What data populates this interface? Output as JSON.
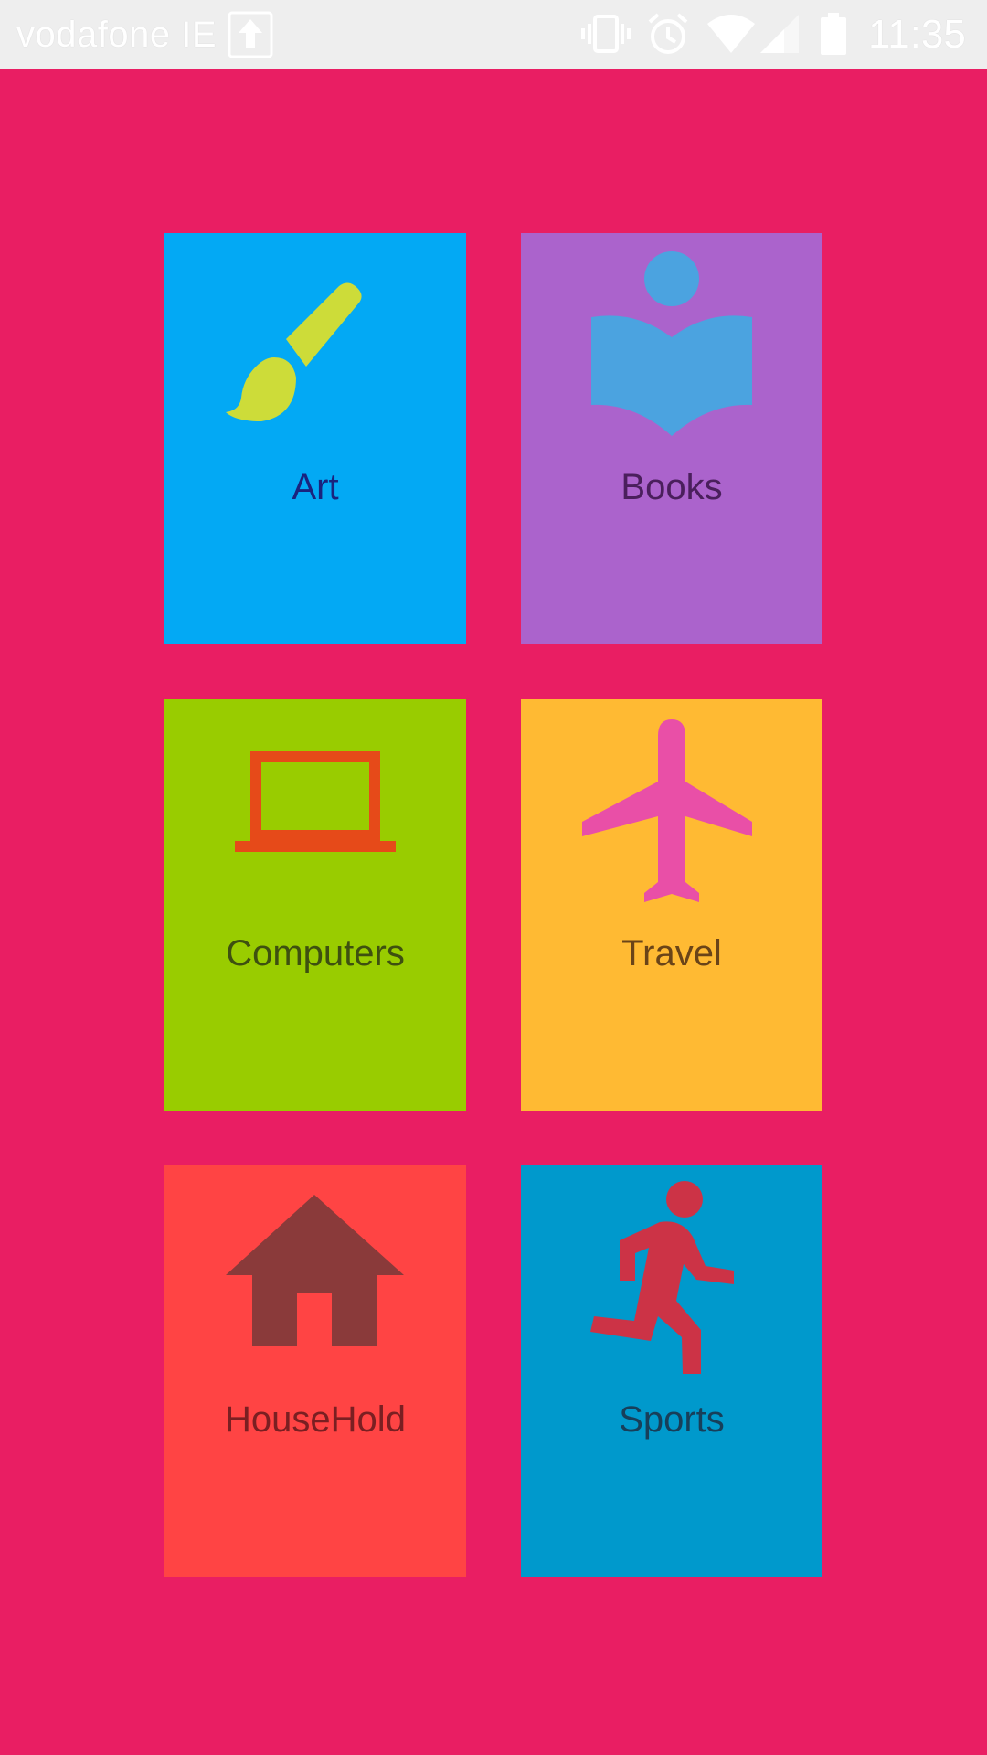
{
  "status_bar": {
    "carrier": "vodafone IE",
    "time": "11:35",
    "icons": [
      "upload-icon",
      "vibrate-icon",
      "alarm-icon",
      "wifi-icon",
      "signal-icon",
      "battery-icon"
    ]
  },
  "categories": [
    {
      "label": "Art",
      "icon": "paintbrush-icon",
      "bg": "#03A9F4",
      "icon_color": "#CDDC39",
      "text_color": "#1A237E"
    },
    {
      "label": "Books",
      "icon": "book-reader-icon",
      "bg": "#AB63CC",
      "icon_color": "#4BA3E0",
      "text_color": "#4A1F5C"
    },
    {
      "label": "Computers",
      "icon": "laptop-icon",
      "bg": "#99CC00",
      "icon_color": "#E64A19",
      "text_color": "#3E5010"
    },
    {
      "label": "Travel",
      "icon": "airplane-icon",
      "bg": "#FFBA33",
      "icon_color": "#E94FA7",
      "text_color": "#6A4418"
    },
    {
      "label": "HouseHold",
      "icon": "house-icon",
      "bg": "#FF4444",
      "icon_color": "#8A3A3A",
      "text_color": "#7A1F22"
    },
    {
      "label": "Sports",
      "icon": "runner-icon",
      "bg": "#0099CC",
      "icon_color": "#CC3346",
      "text_color": "#173F5A"
    }
  ]
}
